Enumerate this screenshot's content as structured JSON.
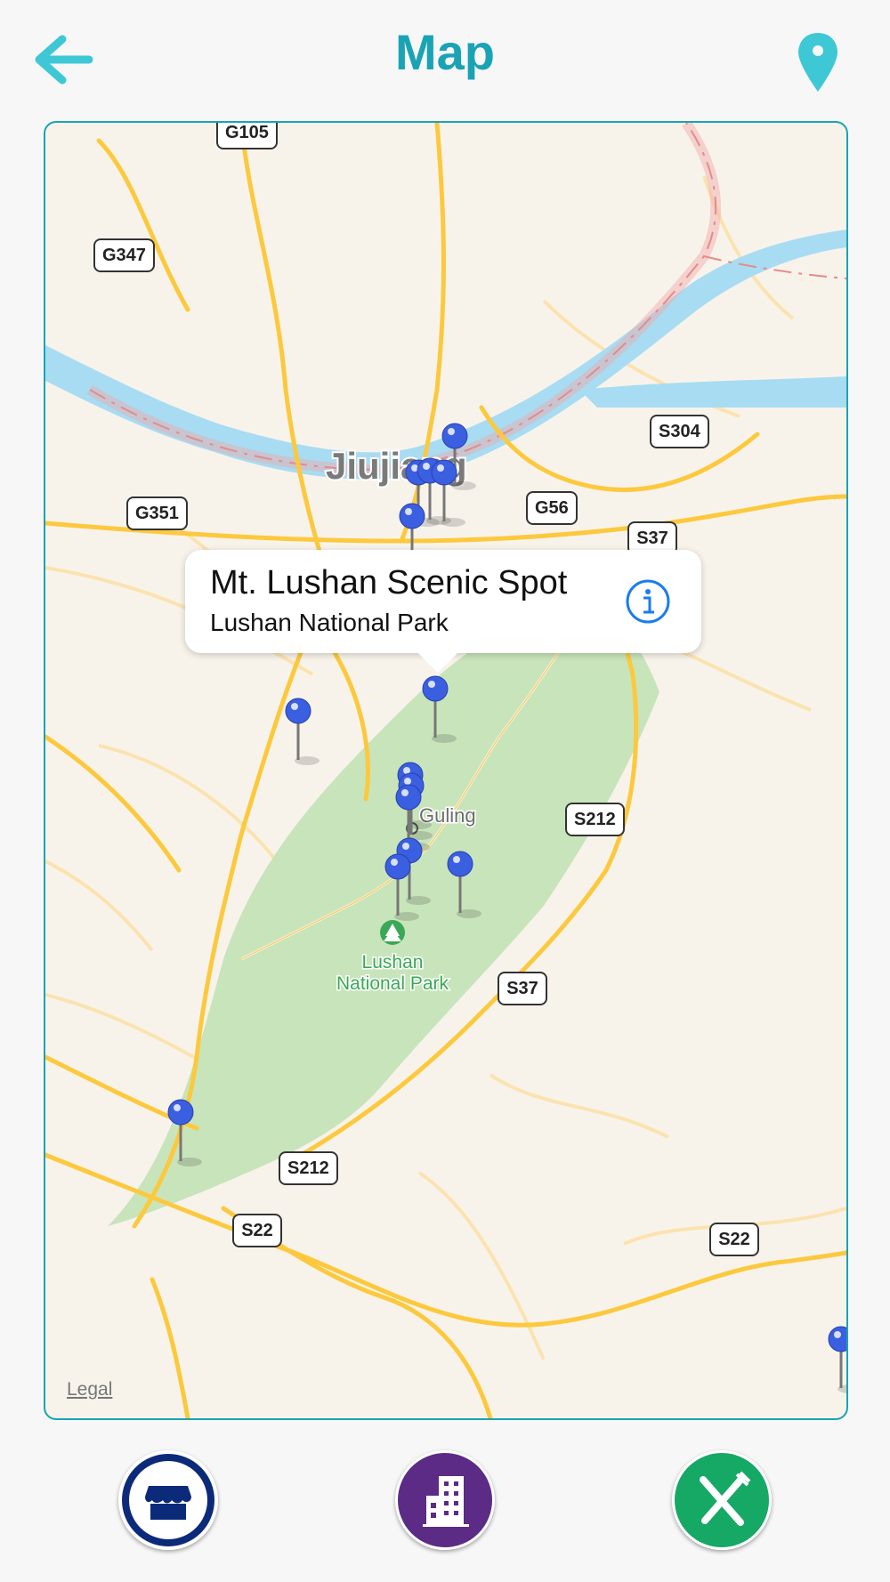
{
  "header": {
    "title": "Map",
    "back_icon": "arrow-left-icon",
    "location_icon": "map-pin-icon",
    "accent": "#1aa3b5"
  },
  "map": {
    "city_label": "Jiujiang",
    "town_label": "Guling",
    "park_label_line1": "Lushan",
    "park_label_line2": "National Park",
    "legal": "Legal",
    "route_shields": [
      "G105",
      "G347",
      "G351",
      "S304",
      "G56",
      "S37",
      "S212",
      "S37",
      "S212",
      "S22",
      "S22"
    ],
    "pin_color": "#3a5fe0",
    "park_color": "#c8e4bb",
    "water_color": "#a8dcf2"
  },
  "callout": {
    "title": "Mt. Lushan Scenic Spot",
    "subtitle": "Lushan National Park",
    "info_icon": "info-icon"
  },
  "bottom_bar": {
    "buttons": [
      {
        "name": "shop",
        "icon": "storefront-icon",
        "color": "#0c2a7a"
      },
      {
        "name": "hotels",
        "icon": "building-icon",
        "color": "#5b2b86"
      },
      {
        "name": "restaurants",
        "icon": "fork-knife-icon",
        "color": "#16a865"
      }
    ]
  }
}
